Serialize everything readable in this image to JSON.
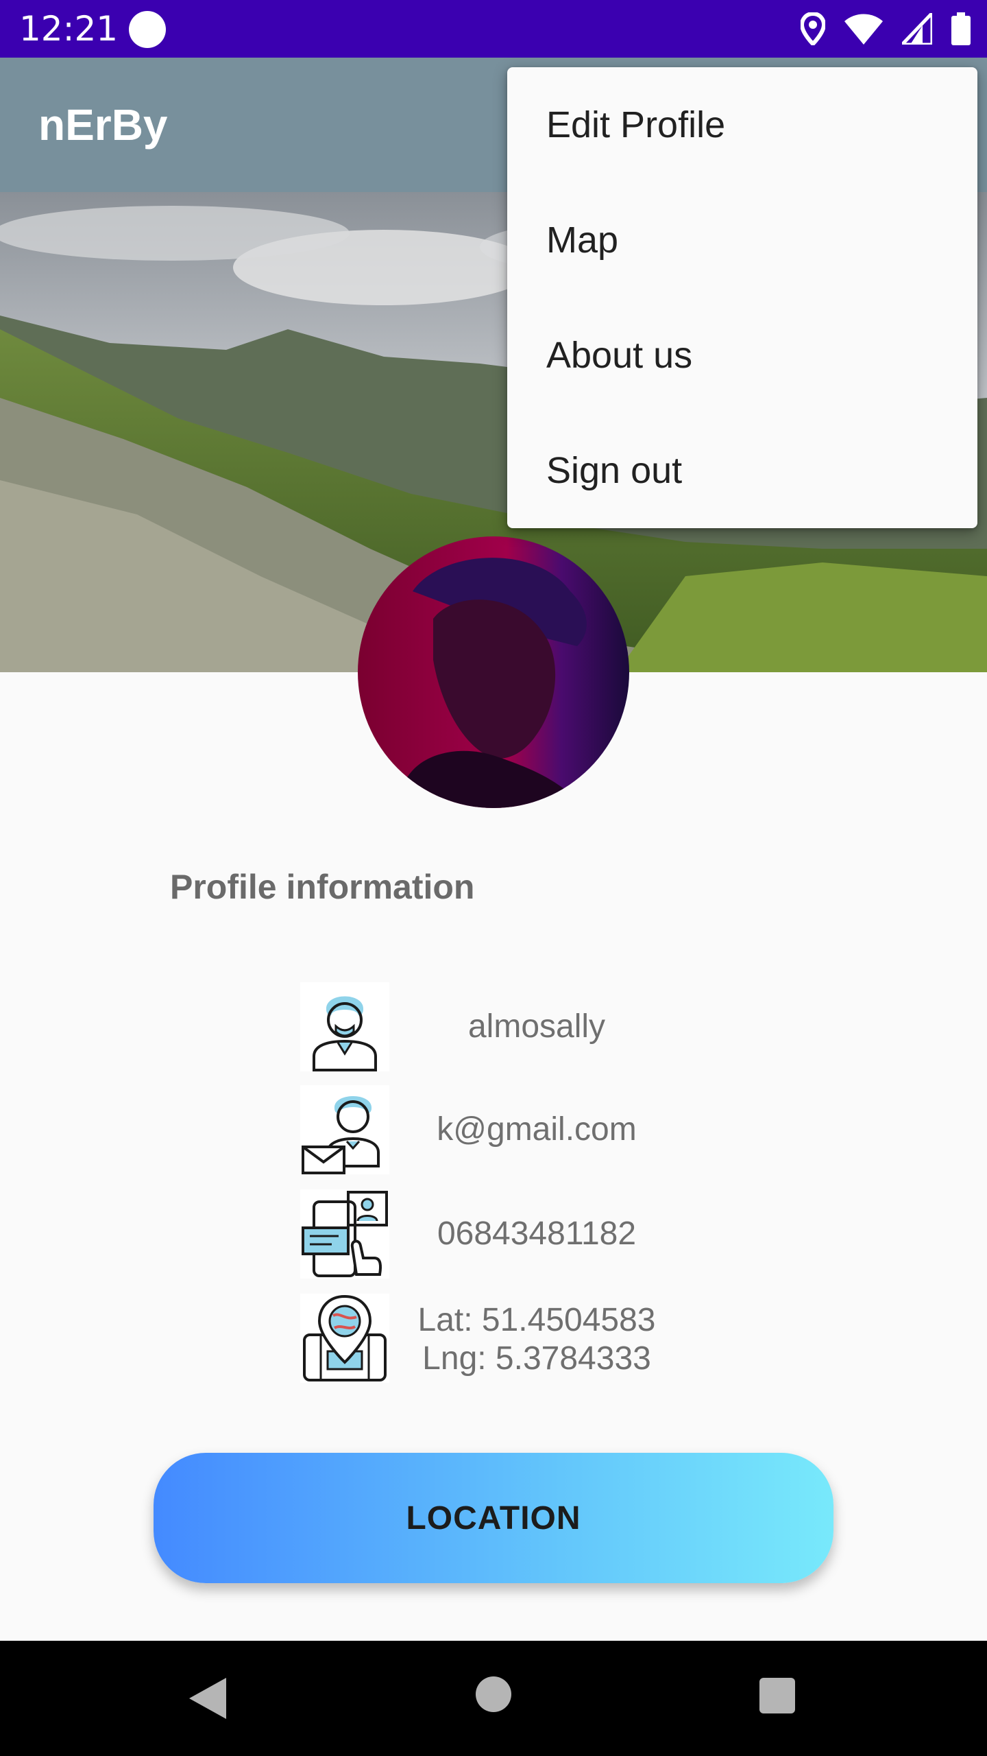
{
  "status_bar": {
    "time": "12:21",
    "icons": [
      "location-icon",
      "wifi-icon",
      "signal-icon",
      "battery-icon"
    ]
  },
  "app_bar": {
    "title": "nErBy",
    "color": "#78909c"
  },
  "menu": {
    "items": [
      {
        "label": "Edit Profile"
      },
      {
        "label": "Map"
      },
      {
        "label": "About us"
      },
      {
        "label": "Sign out"
      }
    ]
  },
  "profile": {
    "section_title": "Profile information",
    "username": "almosally",
    "email": "k@gmail.com",
    "phone": "06843481182",
    "location": {
      "lat": "Lat: 51.4504583",
      "lng": "Lng: 5.3784333"
    }
  },
  "location_button": {
    "label": "LOCATION"
  },
  "colors": {
    "status_bar": "#3b00b0",
    "button_gradient_start": "#448aff",
    "button_gradient_end": "#78e9fb"
  }
}
